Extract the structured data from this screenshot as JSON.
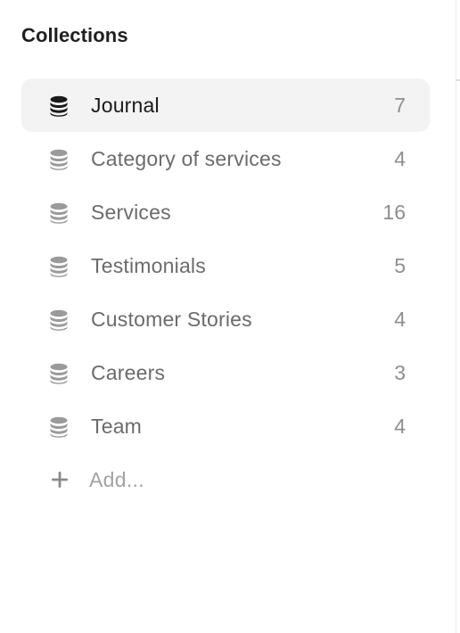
{
  "panel": {
    "title": "Collections"
  },
  "collections": [
    {
      "label": "Journal",
      "count": "7",
      "active": true
    },
    {
      "label": "Category of services",
      "count": "4",
      "active": false
    },
    {
      "label": "Services",
      "count": "16",
      "active": false
    },
    {
      "label": "Testimonials",
      "count": "5",
      "active": false
    },
    {
      "label": "Customer Stories",
      "count": "4",
      "active": false
    },
    {
      "label": "Careers",
      "count": "3",
      "active": false
    },
    {
      "label": "Team",
      "count": "4",
      "active": false
    }
  ],
  "add": {
    "label": "Add..."
  },
  "icons": {
    "collection": "database-icon",
    "add": "plus-icon"
  },
  "colors": {
    "active_bg": "#f3f3f3",
    "active_icon": "#1a1a1a",
    "inactive_icon": "#9a9a9a"
  }
}
